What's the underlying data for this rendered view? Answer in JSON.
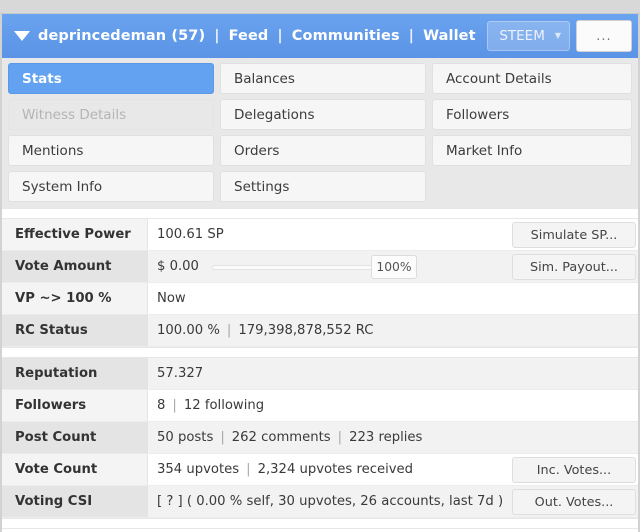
{
  "window": {
    "title_strip": ""
  },
  "navbar": {
    "account_caret_icon": "caret-down-icon",
    "account_label": "deprincedeman (57)",
    "separator": "|",
    "links": [
      {
        "label": "Feed"
      },
      {
        "label": "Communities"
      },
      {
        "label": "Wallet"
      }
    ],
    "chain_select": {
      "value": "STEEM",
      "caret_icon": "chevron-down-icon"
    },
    "overflow_button": {
      "label": "...",
      "icon": "ellipsis-icon"
    },
    "accent_color": "#5b93e6"
  },
  "tabs": [
    {
      "label": "Stats",
      "state": "active"
    },
    {
      "label": "Balances",
      "state": "normal"
    },
    {
      "label": "Account Details",
      "state": "normal"
    },
    {
      "label": "Witness Details",
      "state": "disabled"
    },
    {
      "label": "Delegations",
      "state": "normal"
    },
    {
      "label": "Followers",
      "state": "normal"
    },
    {
      "label": "Mentions",
      "state": "normal"
    },
    {
      "label": "Orders",
      "state": "normal"
    },
    {
      "label": "Market Info",
      "state": "normal"
    },
    {
      "label": "System Info",
      "state": "normal"
    },
    {
      "label": "Settings",
      "state": "normal"
    },
    {
      "label": "",
      "state": "empty"
    }
  ],
  "stats": {
    "section1": [
      {
        "label": "Effective Power",
        "value": "100.61 SP",
        "action": "Simulate SP..."
      },
      {
        "label": "Vote Amount",
        "value": "$ 0.00",
        "slider_value": "100%",
        "action": "Sim. Payout..."
      },
      {
        "label": "VP ~> 100 %",
        "value": "Now"
      },
      {
        "label": "RC Status",
        "value_a": "100.00 %",
        "sep": "|",
        "value_b": "179,398,878,552 RC"
      }
    ],
    "section2": [
      {
        "label": "Reputation",
        "value": "57.327"
      },
      {
        "label": "Followers",
        "value_a": "8",
        "sep": "|",
        "value_b": "12 following"
      },
      {
        "label": "Post Count",
        "value_a": "50 posts",
        "sep1": "|",
        "value_b": "262 comments",
        "sep2": "|",
        "value_c": "223 replies"
      },
      {
        "label": "Vote Count",
        "value_a": "354 upvotes",
        "sep": "|",
        "value_b": "2,324 upvotes received",
        "action": "Inc. Votes..."
      },
      {
        "label": "Voting CSI",
        "value": "[ ? ] ( 0.00 % self, 30 upvotes, 26 accounts, last 7d )",
        "action": "Out. Votes..."
      }
    ]
  }
}
